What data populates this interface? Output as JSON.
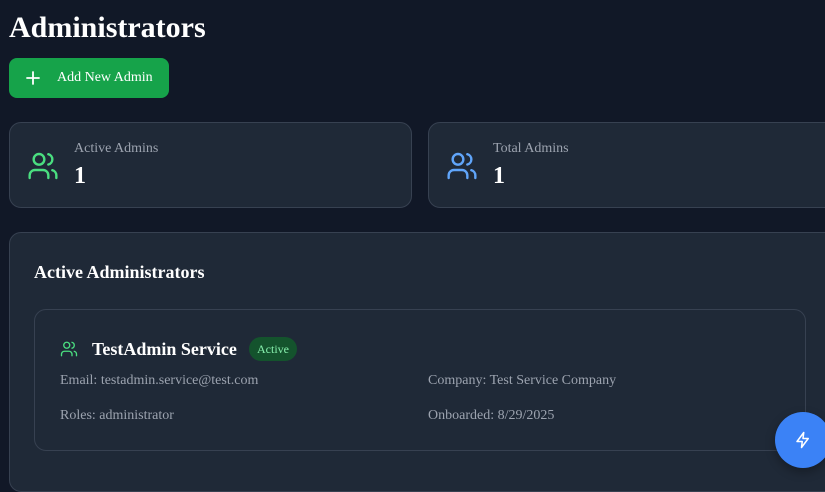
{
  "page": {
    "title": "Administrators"
  },
  "toolbar": {
    "add_label": "Add New Admin",
    "add_icon": "plus-icon"
  },
  "stats": {
    "active": {
      "label": "Active Admins",
      "value": "1",
      "icon": "users-icon",
      "color": "#4ade80"
    },
    "total": {
      "label": "Total Admins",
      "value": "1",
      "icon": "users-icon",
      "color": "#60a5fa"
    }
  },
  "section": {
    "title": "Active Administrators",
    "admins": [
      {
        "name": "TestAdmin Service",
        "status": "Active",
        "email": "Email: testadmin.service@test.com",
        "company": "Company: Test Service Company",
        "roles": "Roles: administrator",
        "onboarded": "Onboarded: 8/29/2025",
        "icon": "users-icon"
      }
    ]
  },
  "fab": {
    "icon": "zap-icon"
  },
  "colors": {
    "background": "#111827",
    "card": "#1f2937",
    "border": "#374151",
    "primary_green": "#16a34a",
    "fab_blue": "#3b82f6",
    "badge_bg": "#14532d",
    "badge_text": "#86efac"
  }
}
